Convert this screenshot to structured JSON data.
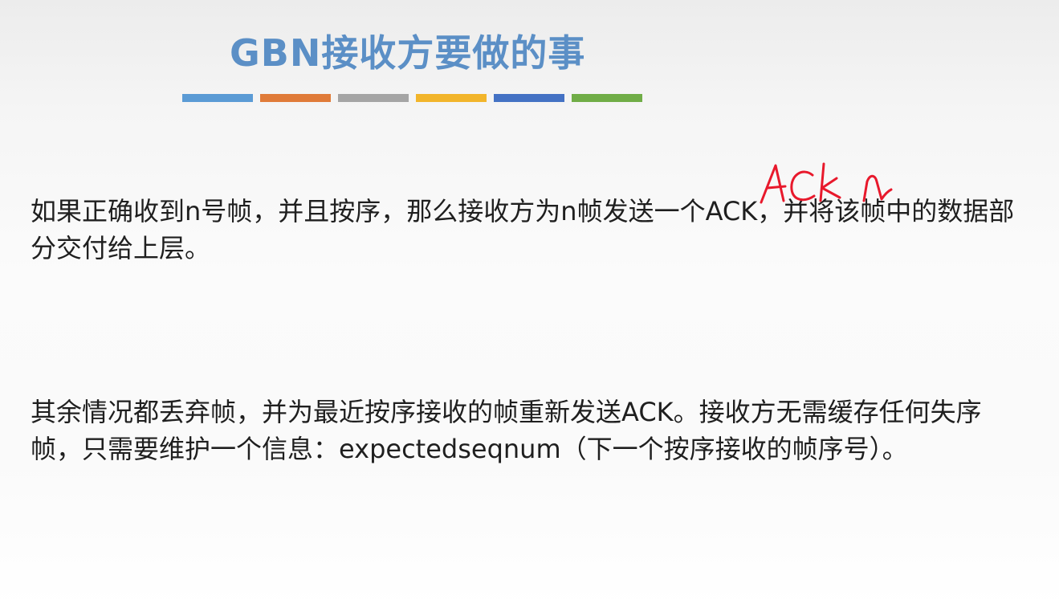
{
  "slide": {
    "title": "GBN接收方要做的事",
    "title_color": "#5b8fc6",
    "color_bar": [
      "#5b9bd5",
      "#e07b39",
      "#a5a5a5",
      "#f2b52b",
      "#4472c4",
      "#70ad47"
    ],
    "paragraphs": [
      "如果正确收到n号帧，并且按序，那么接收方为n帧发送一个ACK，并将该帧中的数据部分交付给上层。",
      "其余情况都丢弃帧，并为最近按序接收的帧重新发送ACK。接收方无需缓存任何失序帧，只需要维护一个信息：expectedseqnum（下一个按序接收的帧序号）。"
    ],
    "annotation": {
      "text": "ACK n",
      "color": "#e8192c"
    }
  }
}
